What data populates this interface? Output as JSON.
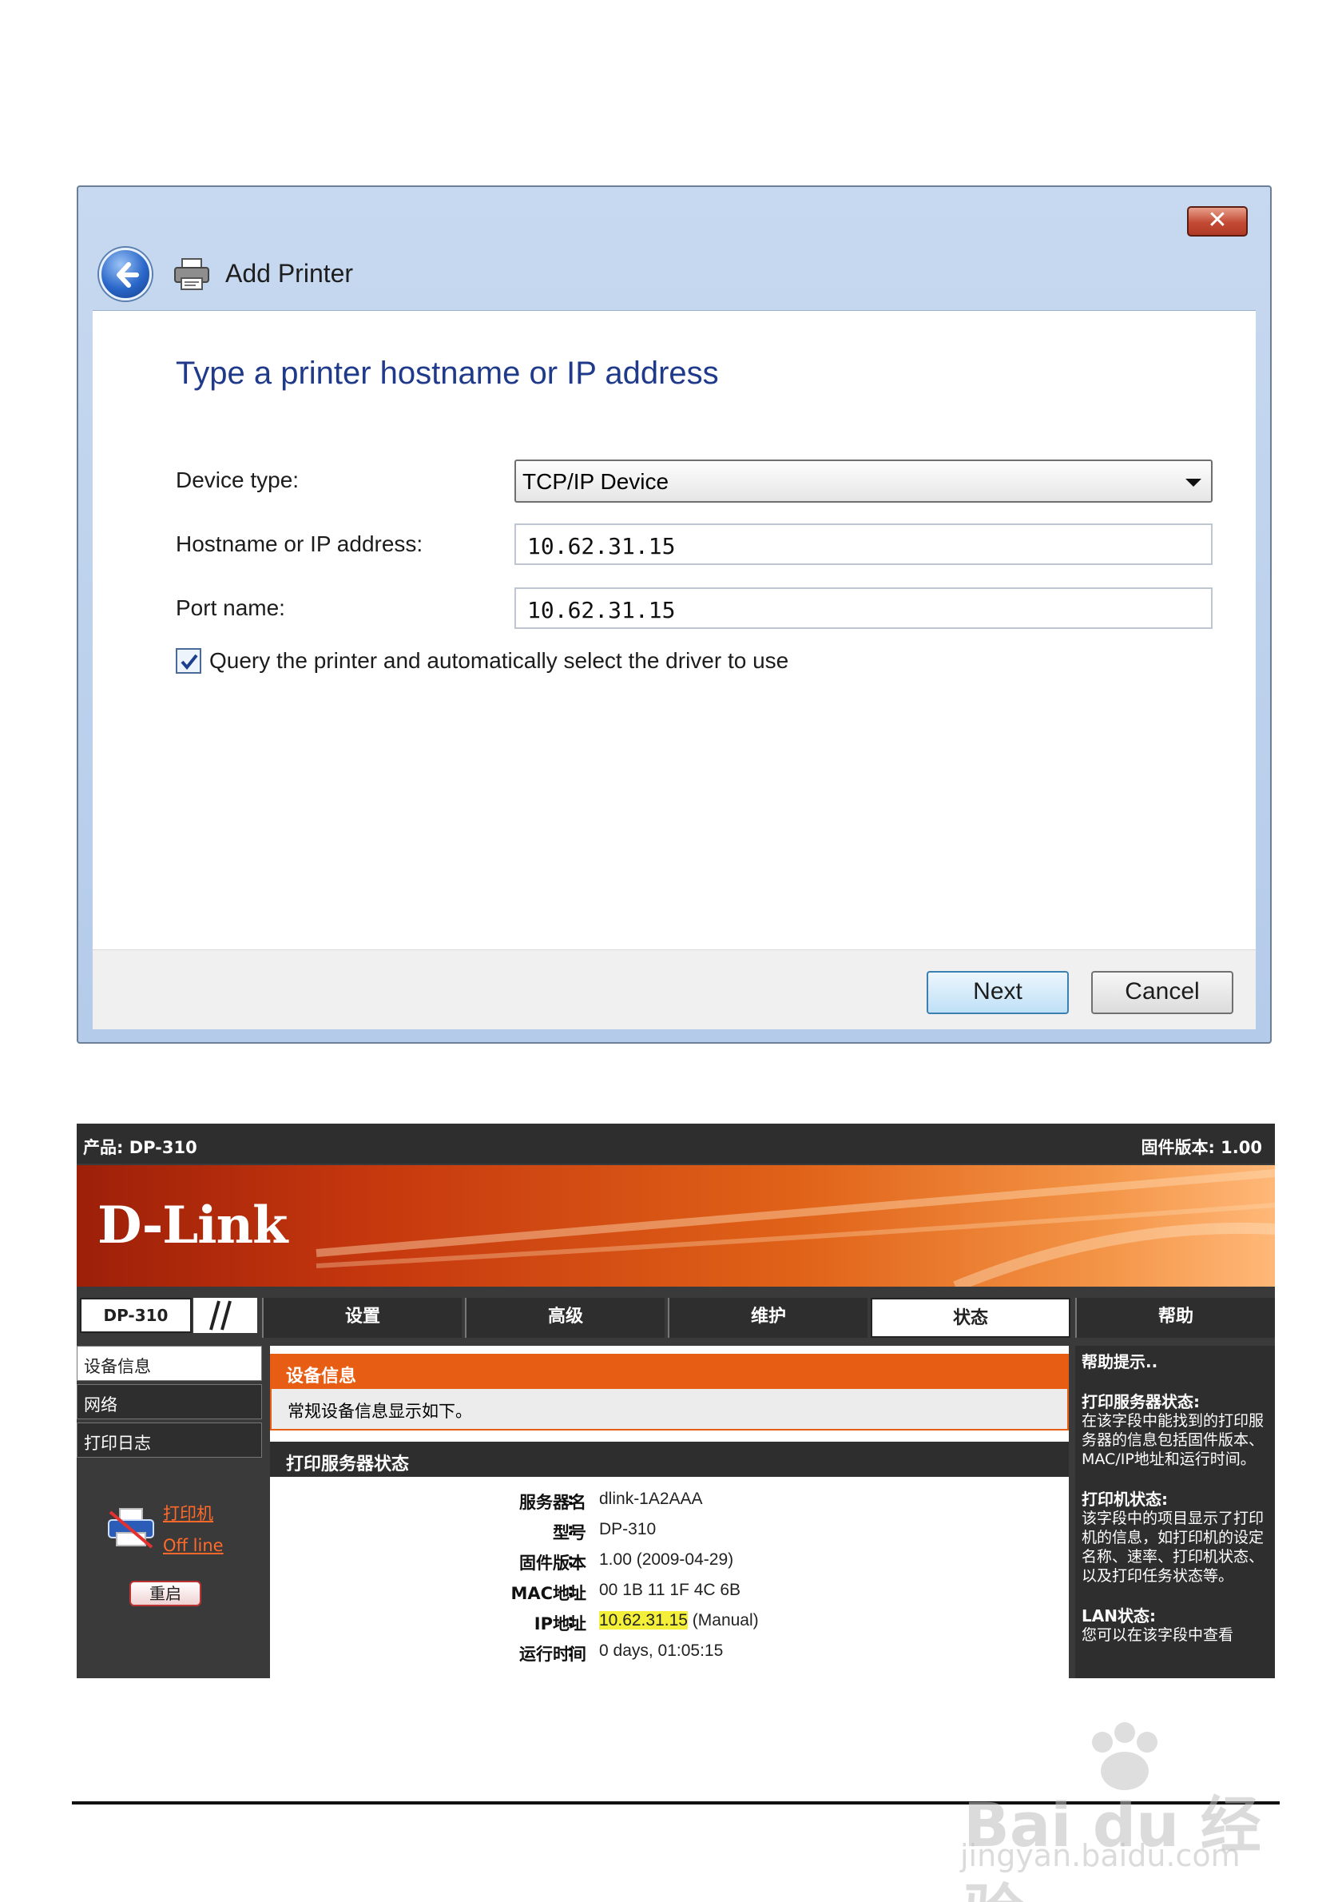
{
  "dialog": {
    "title": "Add Printer",
    "close_glyph": "✕",
    "heading": "Type a printer hostname or IP address",
    "device_type_label": "Device type:",
    "device_type_value": "TCP/IP Device",
    "hostname_label": "Hostname or IP address:",
    "hostname_value": "10.62.31.15",
    "port_label": "Port name:",
    "port_value": "10.62.31.15",
    "query_checked": true,
    "query_label": "Query the printer and automatically select the driver to use",
    "next_label": "Next",
    "cancel_label": "Cancel"
  },
  "dlink": {
    "product_label": "产品: DP-310",
    "firmware_label": "固件版本: 1.00",
    "logo": "D-Link",
    "model_tab": "DP-310",
    "nav": [
      "设置",
      "高级",
      "维护",
      "状态",
      "帮助"
    ],
    "active_nav": "状态",
    "left_items": [
      "设备信息",
      "网络",
      "打印日志"
    ],
    "printer_link": "打印机",
    "printer_state": "Off line",
    "reboot_label": "重启",
    "section_device": "设备信息",
    "section_device_desc": "常规设备信息显示如下。",
    "section_server": "打印服务器状态",
    "info": [
      {
        "key": "服务器名",
        "value": "dlink-1A2AAA"
      },
      {
        "key": "型号",
        "value": "DP-310"
      },
      {
        "key": "固件版本",
        "value": "1.00 (2009-04-29)"
      },
      {
        "key": "MAC地址",
        "value": "00 1B 11 1F 4C 6B"
      },
      {
        "key": "IP地址",
        "value": "10.62.31.15",
        "suffix": "(Manual)"
      },
      {
        "key": "运行时间",
        "value": "0 days, 01:05:15"
      }
    ],
    "help": {
      "title": "帮助提示..",
      "server_title": "打印服务器状态:",
      "server_text": "在该字段中能找到的打印服务器的信息包括固件版本、MAC/IP地址和运行时间。",
      "printer_title": "打印机状态:",
      "printer_text": "该字段中的项目显示了打印机的信息，如打印机的设定名称、速率、打印机状态、以及打印任务状态等。",
      "lan_title": "LAN状态:",
      "lan_text": "您可以在该字段中查看"
    }
  },
  "watermark": {
    "text": "Bai du 经验",
    "url": "jingyan.baidu.com"
  },
  "icons": {
    "back": "back-arrow-icon",
    "printer": "printer-icon",
    "dropdown": "chevron-down-icon",
    "check": "check-icon"
  }
}
